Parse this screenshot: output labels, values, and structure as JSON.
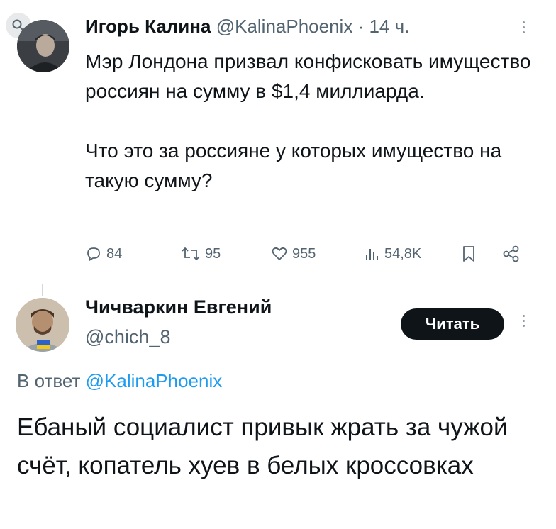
{
  "tweet1": {
    "author_name": "Игорь Калина",
    "handle": "@KalinaPhoenix",
    "time": "· 14 ч.",
    "body": [
      "Мэр Лондона призвал конфисковать имущество россиян на сумму в $1,4 миллиарда.",
      "Что это за россияне у которых имущество на такую сумму?"
    ],
    "actions": {
      "replies": "84",
      "retweets": "95",
      "likes": "955",
      "views": "54,8K"
    }
  },
  "tweet2": {
    "author_name": "Чичваркин Евгений",
    "handle": "@chich_8",
    "follow_label": "Читать",
    "reply_prefix": "В ответ",
    "reply_mention": "@KalinaPhoenix",
    "body": "Ебаный социалист привык жрать за чужой счёт, копатель хуев в белых кроссовках"
  },
  "icons": {
    "search": "search-icon",
    "more": "more-options-icon",
    "reply": "reply-icon",
    "retweet": "retweet-icon",
    "like": "heart-icon",
    "views": "views-icon",
    "bookmark": "bookmark-icon",
    "share": "share-icon"
  },
  "colors": {
    "text": "#0f1419",
    "muted": "#536471",
    "link": "#1d9bf0",
    "button": "#0f1419"
  }
}
